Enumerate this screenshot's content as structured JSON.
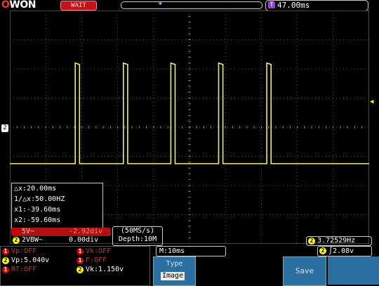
{
  "brand": {
    "o": "O",
    "rest": "WON"
  },
  "top": {
    "run_status": "WAIT",
    "trig_marker": "T",
    "time_t": "T",
    "time_offset": "47.00ms"
  },
  "screen": {
    "grid": {
      "cols": 10,
      "rows": 8
    },
    "trace_color": "#f2ef5a",
    "pulse_positions_div": [
      1.82,
      3.16,
      4.48,
      5.81,
      7.15
    ],
    "baseline_div": 5.25,
    "pulse_high_div": 1.8,
    "ch2_marker": "2",
    "trig_level_marker": "◀"
  },
  "cursor": {
    "dx": "△x:20.00ms",
    "inv_dx": "1/△x:50.00HZ",
    "x1": "x1:-39.60ms",
    "x2": "x2:-59.60ms"
  },
  "channels": {
    "ch1_label": "5V~",
    "ch1_value": "-2.92div",
    "ch2_num": "2",
    "ch2_label": "2VBW~",
    "ch2_value": "0.00div"
  },
  "acquire": {
    "rate": "(50MS/s)",
    "depth": "Depth:10M"
  },
  "freq": {
    "num": "2",
    "value": "3.72529Hz"
  },
  "measure": {
    "vp_off": "Vp:OFF",
    "vp": "Vp:5.040v",
    "rt_off": "RT:OFF",
    "vk_off": "Vk:OFF",
    "f_off": "F:OFF",
    "vk": "Vk:1.150v",
    "ch1": "1",
    "ch2": "2"
  },
  "timebase": {
    "m": "M:10ms"
  },
  "trigger": {
    "num": "2",
    "edge": "∫",
    "level": "2.08v"
  },
  "menu": {
    "type_label": "Type",
    "type_value": "Image",
    "save_label": "Save"
  },
  "colors": {
    "accent": "#2b6fa0",
    "ch1": "#c0141a",
    "ch2": "#ffff00",
    "grid": "#555555"
  }
}
